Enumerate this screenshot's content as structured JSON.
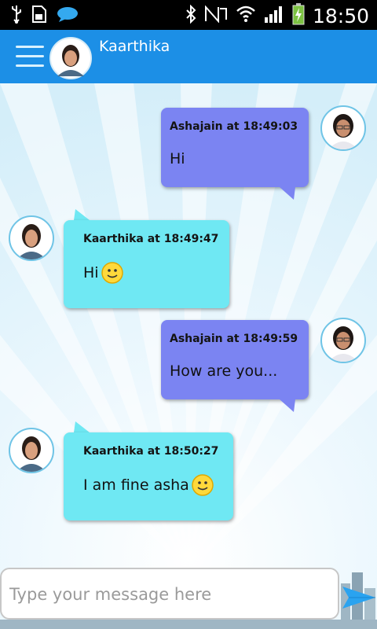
{
  "status_bar": {
    "time": "18:50",
    "left_icons": [
      "usb-icon",
      "sd-card-icon",
      "chat-notification-icon"
    ],
    "right_icons": [
      "bluetooth-icon",
      "nfc-icon",
      "wifi-icon",
      "signal-icon",
      "battery-icon"
    ]
  },
  "header": {
    "contact_name": "Kaarthika",
    "menu_icon": "hamburger-menu-icon",
    "accent": "#1c8fe6"
  },
  "messages": [
    {
      "direction": "out",
      "sender": "Ashajain",
      "meta": "Ashajain  at 18:49:03",
      "text": "Hi",
      "emoji": false
    },
    {
      "direction": "in",
      "sender": "Kaarthika",
      "meta": "Kaarthika  at 18:49:47",
      "text": "Hi",
      "emoji": true
    },
    {
      "direction": "out",
      "sender": "Ashajain",
      "meta": "Ashajain  at 18:49:59",
      "text": "How are you...",
      "emoji": false
    },
    {
      "direction": "in",
      "sender": "Kaarthika",
      "meta": "Kaarthika  at 18:50:27",
      "text": "I am fine asha",
      "emoji": true
    }
  ],
  "colors": {
    "outgoing_bubble": "#7b84f2",
    "incoming_bubble": "#6fe8f3"
  },
  "composer": {
    "placeholder": "Type your message here",
    "value": "",
    "send_icon": "send-arrow-icon"
  }
}
